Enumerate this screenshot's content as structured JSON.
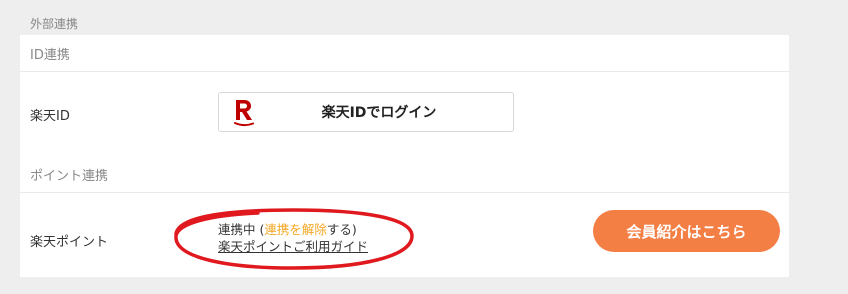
{
  "section": {
    "heading": "外部連携"
  },
  "id_link": {
    "subheading": "ID連携",
    "label": "楽天ID",
    "login_button": "楽天IDでログイン"
  },
  "point_link": {
    "subheading": "ポイント連携",
    "label": "楽天ポイント",
    "status_prefix": "連携中 (",
    "unlink_link": "連携を解除",
    "status_suffix": "する)",
    "guide_link": "楽天ポイントご利用ガイド",
    "referral_button": "会員紹介はこちら"
  },
  "colors": {
    "rakuten_red": "#bf0000",
    "link_orange": "#f5a623",
    "button_orange": "#f47f45",
    "annotation_red": "#e0191f"
  },
  "icons": {
    "logo": "rakuten-r-logo-icon"
  }
}
